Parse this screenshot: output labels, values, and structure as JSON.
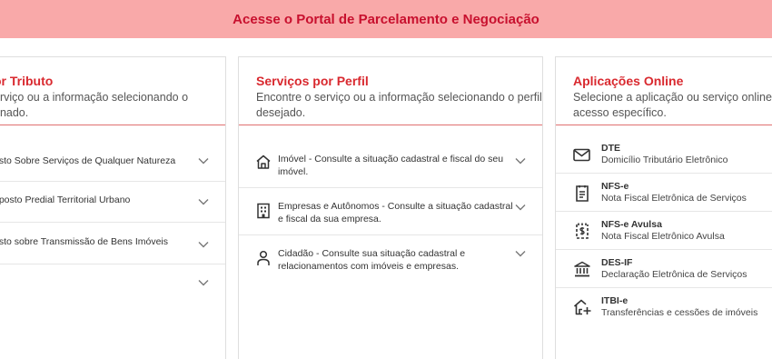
{
  "banner": {
    "text": "Acesse o Portal de Parcelamento e Negociação"
  },
  "tributo": {
    "title": "or Tributo",
    "desc_line1": "erviço ou a informação selecionando o",
    "desc_line2": "onado.",
    "items": [
      {
        "label": "osto Sobre Serviços de Qualquer Natureza"
      },
      {
        "label": "oposto Predial Territorial Urbano"
      },
      {
        "label": "osto sobre Transmissão de Bens Imóveis"
      },
      {
        "label": ""
      }
    ]
  },
  "perfil": {
    "title": "Serviços por Perfil",
    "desc_line1": "Encontre o serviço ou a informação selecionando o perfil",
    "desc_line2": "desejado.",
    "items": [
      {
        "line1": "Imóvel - Consulte a situação cadastral e fiscal do seu",
        "line2": "imóvel.",
        "icon": "house-icon"
      },
      {
        "line1": "Empresas e Autônomos - Consulte a situação cadastral",
        "line2": "e fiscal da sua empresa.",
        "icon": "building-icon"
      },
      {
        "line1": "Cidadão - Consulte sua situação cadastral e",
        "line2": "relacionamentos com imóveis e empresas.",
        "icon": "person-icon"
      }
    ]
  },
  "aplicacoes": {
    "title": "Aplicações Online",
    "desc_line1": "Selecione a aplicação ou serviço online de",
    "desc_line2": "acesso específico.",
    "items": [
      {
        "title": "DTE",
        "subtitle": "Domicílio Tributário Eletrônico",
        "icon": "mail-icon"
      },
      {
        "title": "NFS-e",
        "subtitle": "Nota Fiscal Eletrônica de Serviços",
        "icon": "invoice-icon"
      },
      {
        "title": "NFS-e Avulsa",
        "subtitle": "Nota Fiscal Eletrônico Avulsa",
        "icon": "invoice-dollar-icon"
      },
      {
        "title": "DES-IF",
        "subtitle": "Declaração Eletrônica de Serviços",
        "icon": "bank-icon"
      },
      {
        "title": "ITBI-e",
        "subtitle": "Transferências e cessões de imóveis",
        "icon": "house-plus-icon"
      }
    ]
  }
}
